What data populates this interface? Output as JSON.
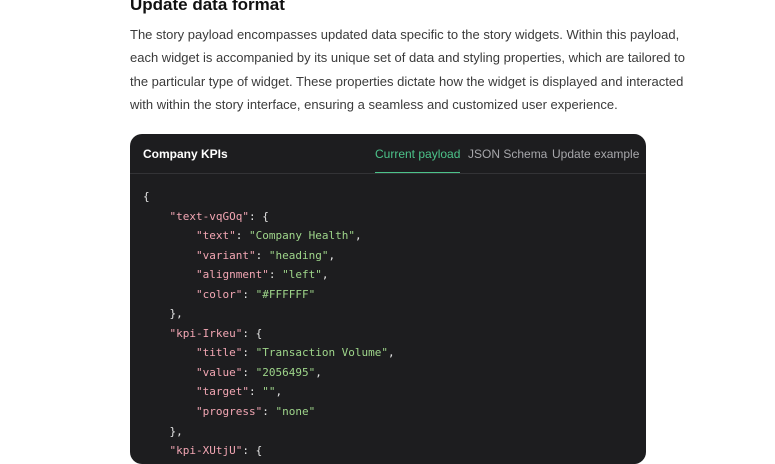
{
  "section": {
    "title": "Update data format",
    "paragraph_lines": [
      "The story payload encompasses updated data specific to the story widgets. Within this payload,",
      "each widget is accompanied by its unique set of data and styling properties, which are tailored to",
      "the particular type of widget. These properties dictate how the widget is displayed and interacted",
      "with within the story interface, ensuring a seamless and customized user experience."
    ]
  },
  "card": {
    "title": "Company KPIs",
    "tabs": [
      {
        "label": "Current payload",
        "active": true
      },
      {
        "label": "JSON Schema",
        "active": false
      },
      {
        "label": "Update example",
        "active": false
      }
    ],
    "accent_color": "#4cc38a"
  },
  "code": {
    "open": "{",
    "widgets": [
      {
        "key": "\"text-vqGOq\"",
        "fields": [
          {
            "k": "\"text\"",
            "v": "\"Company Health\""
          },
          {
            "k": "\"variant\"",
            "v": "\"heading\""
          },
          {
            "k": "\"alignment\"",
            "v": "\"left\""
          },
          {
            "k": "\"color\"",
            "v": "\"#FFFFFF\""
          }
        ]
      },
      {
        "key": "\"kpi-Irkeu\"",
        "fields": [
          {
            "k": "\"title\"",
            "v": "\"Transaction Volume\""
          },
          {
            "k": "\"value\"",
            "v": "\"2056495\""
          },
          {
            "k": "\"target\"",
            "v": "\"\""
          },
          {
            "k": "\"progress\"",
            "v": "\"none\""
          }
        ]
      },
      {
        "key": "\"kpi-XUtjU\"",
        "fields": []
      }
    ]
  }
}
